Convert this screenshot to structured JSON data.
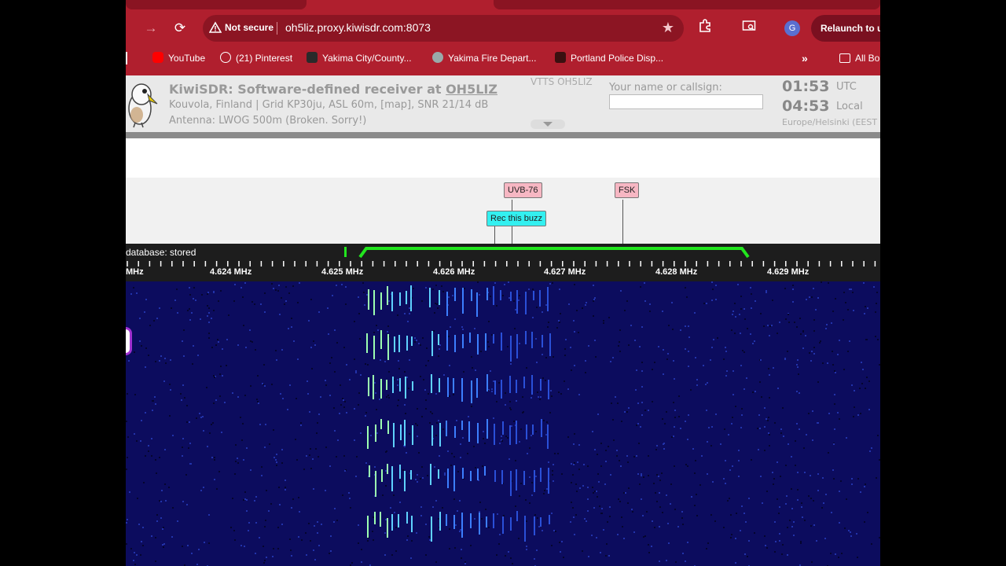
{
  "browser": {
    "nav_forward": "→",
    "nav_reload": "⟳",
    "security_warning_icon": "warning-triangle-icon",
    "not_secure_label": "Not secure",
    "url": "oh5liz.proxy.kiwisdr.com:8073",
    "relaunch_label": "Relaunch to u",
    "profile_initial": "G",
    "bookmarks": [
      {
        "label": "YouTube"
      },
      {
        "label": "(21) Pinterest"
      },
      {
        "label": "Yakima City/County..."
      },
      {
        "label": "Yakima Fire Depart..."
      },
      {
        "label": "Portland Police Disp..."
      }
    ],
    "bookmarks_overflow": "»",
    "all_bookmarks_label": "All Bo"
  },
  "kiwi": {
    "title_prefix": "KiwiSDR: Software-defined receiver at ",
    "station": "OH5LIZ",
    "location_line": "Kouvola, Finland | Grid KP30ju, ASL 60m, [map], SNR 21/14 dB",
    "antenna_line": "Antenna: LWOG 500m (Broken. Sorry!)",
    "vtts": "VTTS OH5LIZ",
    "callsign_label": "Your name or callsign:",
    "callsign_value": "",
    "utc_time": "01:53",
    "utc_label": "UTC",
    "local_time": "04:53",
    "local_label": "Local",
    "timezone": "Europe/Helsinki (EEST"
  },
  "dx_labels": {
    "uvb": "UVB-76",
    "fsk": "FSK",
    "rec": "Rec this buzz"
  },
  "scale": {
    "database_status": "database: stored",
    "freq_labels": [
      "MHz",
      "4.624 MHz",
      "4.625 MHz",
      "4.626 MHz",
      "4.627 MHz",
      "4.628 MHz",
      "4.629 MHz"
    ]
  },
  "colors": {
    "browser_chrome": "#b01f2e",
    "passband": "#22e61e",
    "waterfall_bg": "#0c0c5e",
    "dx_pink": "#f7b7c3",
    "dx_cyan": "#33f0f0"
  }
}
